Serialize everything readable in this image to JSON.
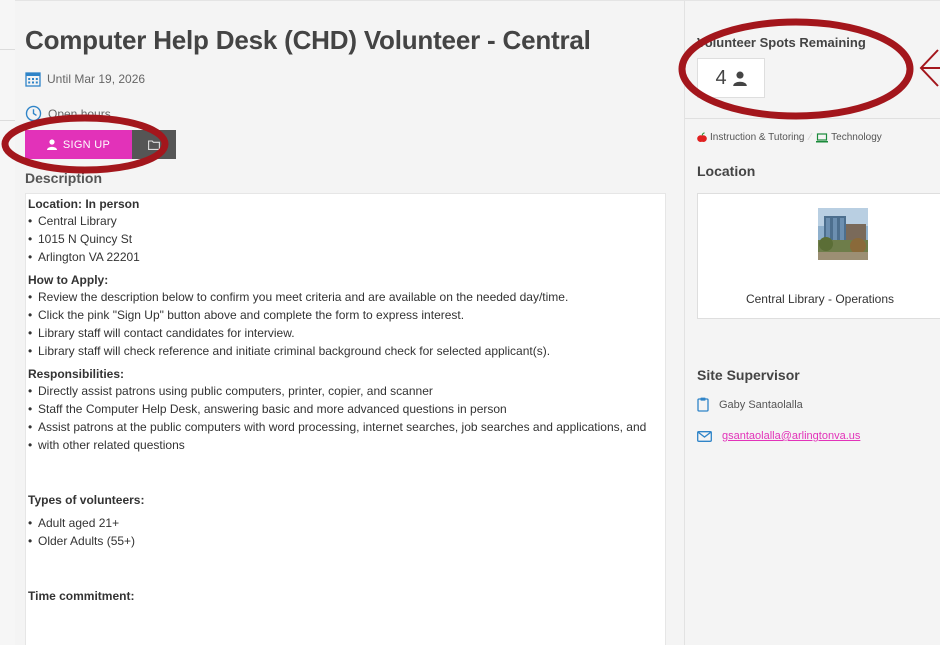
{
  "opportunity": {
    "title": "Computer Help Desk (CHD) Volunteer - Central",
    "date_text": "Until Mar 19, 2026",
    "hours_text": "Open hours",
    "signup_label": "SIGN UP",
    "description_heading": "Description"
  },
  "description": {
    "location_heading": "Location: In person",
    "location_items": [
      "Central Library",
      "1015 N Quincy St",
      "Arlington VA 22201"
    ],
    "apply_heading": "How to Apply:",
    "apply_items": [
      "Review the description below to confirm you meet criteria and are available on the needed day/time.",
      "Click the pink \"Sign Up\" button above and complete the form to express interest.",
      "Library staff will contact candidates for interview.",
      "Library staff will check reference and initiate criminal background check for selected applicant(s)."
    ],
    "resp_heading": "Responsibilities:",
    "resp_items": [
      "Directly assist patrons using public computers, printer, copier, and scanner",
      "Staff the Computer Help Desk, answering basic and more advanced questions in person",
      "Assist patrons at the public computers with word processing, internet searches, job searches and applications, and",
      "with other related questions"
    ],
    "types_heading": "Types of volunteers:",
    "types_items": [
      "Adult aged 21+",
      "Older Adults (55+)"
    ],
    "time_heading": "Time commitment:"
  },
  "sidebar": {
    "spots_title": "Volunteer Spots Remaining",
    "spots_count": "4",
    "tags": [
      "Instruction & Tutoring",
      "Technology"
    ],
    "location_heading": "Location",
    "location_name": "Central Library - Operations",
    "supervisor_heading": "Site Supervisor",
    "supervisor_name": "Gaby Santaolalla",
    "supervisor_email": "gsantaolalla@arlingtonva.us"
  },
  "colors": {
    "accent": "#e232b9",
    "annotation": "#a3161c",
    "icon_blue": "#2f84c8"
  },
  "icons": [
    "calendar-icon",
    "clock-icon",
    "user-icon",
    "folder-icon",
    "apple-icon",
    "laptop-icon",
    "clipboard-icon",
    "envelope-icon"
  ]
}
